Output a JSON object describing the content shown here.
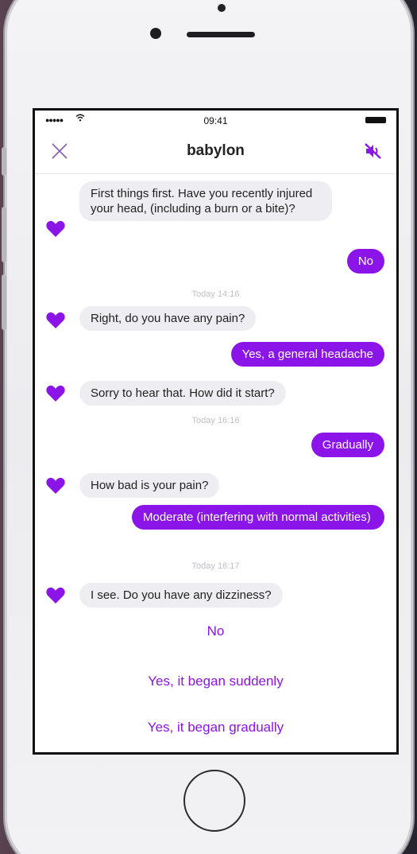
{
  "status": {
    "time": "09:41"
  },
  "header": {
    "title": "babylon"
  },
  "colors": {
    "accent": "#8b14e8",
    "bot_bubble": "#eeeef2",
    "timestamp": "#c0c0c6"
  },
  "icons": [
    "close-icon",
    "mute-icon",
    "heart-icon"
  ],
  "messages": [
    {
      "from": "bot",
      "text": "First things first. Have you recently injured your head, (including a burn or a bite)?"
    },
    {
      "from": "user",
      "text": "No"
    },
    {
      "type": "timestamp",
      "text": "Today 14:16"
    },
    {
      "from": "bot",
      "text": "Right, do you have any pain?"
    },
    {
      "from": "user",
      "text": "Yes, a general headache"
    },
    {
      "from": "bot",
      "text": "Sorry to hear that. How did it start?"
    },
    {
      "type": "timestamp",
      "text": "Today 16:16"
    },
    {
      "from": "user",
      "text": "Gradually"
    },
    {
      "from": "bot",
      "text": "How bad is your pain?"
    },
    {
      "from": "user",
      "text": "Moderate (interfering with normal activities)"
    },
    {
      "type": "timestamp",
      "text": "Today 16:17"
    },
    {
      "from": "bot",
      "text": "I see. Do you have any dizziness?"
    }
  ],
  "options": [
    "No",
    "Yes, it began suddenly",
    "Yes, it began gradually"
  ]
}
